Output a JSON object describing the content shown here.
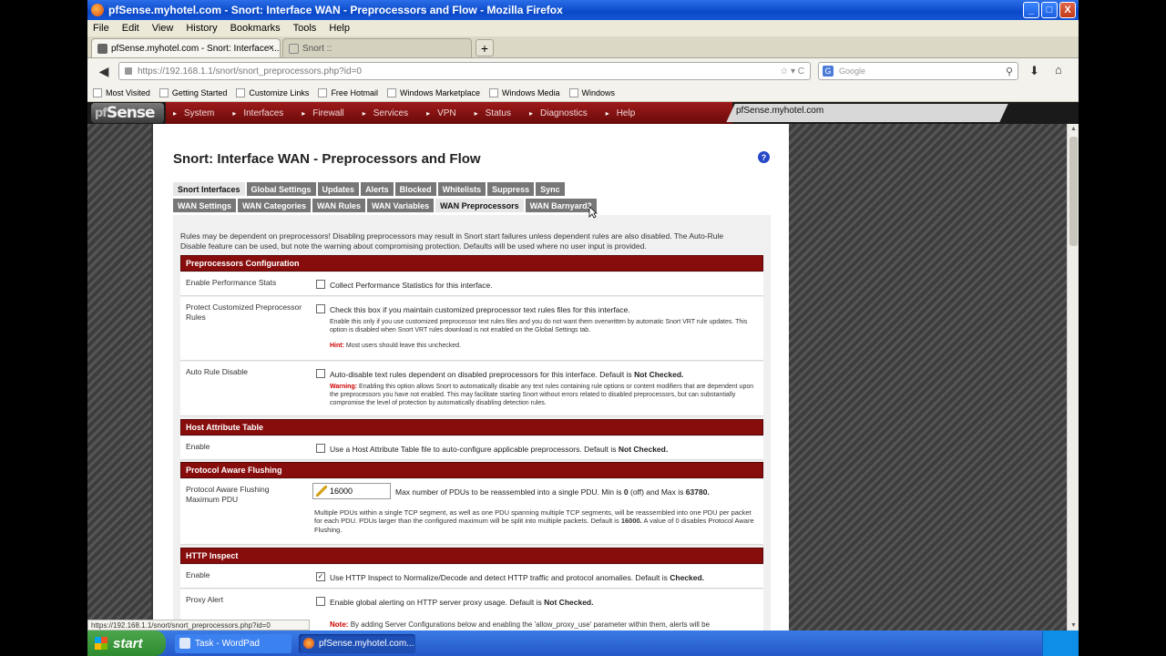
{
  "window": {
    "title": "pfSense.myhotel.com - Snort: Interface WAN - Preprocessors and Flow - Mozilla Firefox",
    "controls": [
      "_",
      "□",
      "X"
    ]
  },
  "menu": [
    "File",
    "Edit",
    "View",
    "History",
    "Bookmarks",
    "Tools",
    "Help"
  ],
  "tabs": [
    {
      "label": "pfSense.myhotel.com - Snort: Interface ...",
      "close": "×"
    },
    {
      "label": "Snort ::"
    }
  ],
  "newtab": "+",
  "nav": {
    "url": "https://192.168.1.1/snort/snort_preprocessors.php?id=0",
    "url_controls": "☆ ▾ C",
    "search_placeholder": "Google"
  },
  "bookmarks": [
    "Most Visited",
    "Getting Started",
    "Customize Links",
    "Free Hotmail",
    "Windows Marketplace",
    "Windows Media",
    "Windows"
  ],
  "pfsense": {
    "logo": "Sense",
    "nav": [
      "System",
      "Interfaces",
      "Firewall",
      "Services",
      "VPN",
      "Status",
      "Diagnostics",
      "Help"
    ],
    "host": "pfSense.myhotel.com"
  },
  "page": {
    "title": "Snort: Interface WAN - Preprocessors and Flow",
    "help": "?",
    "tabs_row1": [
      "Snort Interfaces",
      "Global Settings",
      "Updates",
      "Alerts",
      "Blocked",
      "Whitelists",
      "Suppress",
      "Sync"
    ],
    "tabs_row2": [
      "WAN Settings",
      "WAN Categories",
      "WAN Rules",
      "WAN Variables",
      "WAN Preprocessors",
      "WAN Barnyard2"
    ],
    "intro": "Rules may be dependent on preprocessors! Disabling preprocessors may result in Snort start failures unless dependent rules are also disabled. The Auto-Rule Disable feature can be used, but note the warning about compromising protection. Defaults will be used where no user input is provided."
  },
  "sections": {
    "preproc": {
      "header": "Preprocessors Configuration",
      "perf_label": "Enable Performance Stats",
      "perf_text": "Collect Performance Statistics for this interface.",
      "protect_label": "Protect Customized Preprocessor Rules",
      "protect_text": "Check this box if you maintain customized preprocessor text rules files for this interface.",
      "protect_note": "Enable this only if you use customized preprocessor text rules files and you do not want them overwritten by automatic Snort VRT rule updates. This option is disabled when Snort VRT rules download is not enabled on the Global Settings tab.",
      "hint_label": "Hint:",
      "hint_text": "Most users should leave this unchecked.",
      "autorule_label": "Auto Rule Disable",
      "autorule_text": "Auto-disable text rules dependent on disabled preprocessors for this interface. Default is",
      "autorule_default": "Not Checked.",
      "warning_label": "Warning:",
      "warning_text": "Enabling this option allows Snort to automatically disable any text rules containing rule options or content modifiers that are dependent upon the preprocessors you have not enabled. This may facilitate starting Snort without errors related to disabled preprocessors, but can substantially compromise the level of protection by automatically disabling detection rules."
    },
    "host_attr": {
      "header": "Host Attribute Table",
      "enable_label": "Enable",
      "enable_text": "Use a Host Attribute Table file to auto-configure applicable preprocessors. Default is",
      "enable_default": "Not Checked."
    },
    "paf": {
      "header": "Protocol Aware Flushing",
      "label": "Protocol Aware Flushing Maximum PDU",
      "value": "16000",
      "text_a": "Max number of PDUs to be reassembled into a single PDU. Min is",
      "min": "0",
      "text_b": "(off) and Max is",
      "max": "63780.",
      "note_a": "Multiple PDUs within a single TCP segment, as well as one PDU spanning multiple TCP segments, will be reassembled into one PDU per packet for each PDU. PDUs larger than the configured maximum will be split into multiple packets. Default is",
      "note_default": "16000.",
      "note_b": "A value of 0 disables Protocol Aware Flushing."
    },
    "http": {
      "header": "HTTP Inspect",
      "enable_label": "Enable",
      "enable_text": "Use HTTP Inspect to Normalize/Decode and detect HTTP traffic and protocol anomalies. Default is",
      "enable_default": "Checked.",
      "proxy_label": "Proxy Alert",
      "proxy_text": "Enable global alerting on HTTP server proxy usage. Default is",
      "proxy_default": "Not Checked.",
      "note_label": "Note:",
      "note_text": "By adding Server Configurations below and enabling the 'allow_proxy_use' parameter within them, alerts will be"
    }
  },
  "statusbar": "https://192.168.1.1/snort/snort_preprocessors.php?id=0",
  "taskbar": {
    "start": "start",
    "tasks": [
      "Task - WordPad",
      "pfSense.myhotel.com..."
    ]
  },
  "checkboxes": {
    "perf": false,
    "protect": false,
    "autorule": false,
    "hostattr": false,
    "http": true,
    "proxy": false
  },
  "colors": {
    "section_header": "#870d0d",
    "pfsense_nav": "#9e1a1a",
    "xp_titlebar": "#0a48c8"
  }
}
